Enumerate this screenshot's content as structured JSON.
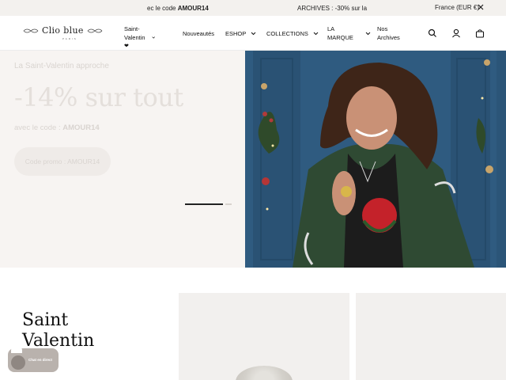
{
  "announcement": {
    "message1_prefix": "ec le code ",
    "message1_code": "AMOUR14",
    "message2": "ARCHIVES : -30% sur la",
    "locale_label": "France (EUR €)",
    "close_icon": "close-icon"
  },
  "header": {
    "logo_text_left": "Clio",
    "logo_text_right": "blue",
    "logo_subtext": "PARIS",
    "nav": [
      {
        "label_line1": "Saint-Valentin",
        "label_line2": "❤",
        "has_chevron": true
      },
      {
        "label": "Nouveautés",
        "has_chevron": false
      },
      {
        "label": "ESHOP",
        "has_chevron": true
      },
      {
        "label": "COLLECTIONS",
        "has_chevron": true
      },
      {
        "label_line1": "LA",
        "label_line2": "MARQUE",
        "has_chevron": true
      },
      {
        "label_line1": "Nos",
        "label_line2": "Archives",
        "has_chevron": false
      }
    ],
    "icons": [
      "search-icon",
      "account-icon",
      "cart-icon"
    ]
  },
  "hero": {
    "kicker": "La Saint-Valentin approche",
    "title": "-14% sur tout",
    "code_prefix": "avec le code : ",
    "code": "AMOUR14",
    "button_label": "Code promo : AMOUR14",
    "slides": 2,
    "active_slide": 1
  },
  "section": {
    "title_line1": "Saint",
    "title_line2": "Valentin"
  },
  "chat": {
    "label": "Chat en direct"
  },
  "colors": {
    "hero_bg": "#f7f4f2",
    "hero_text": "#e4dfdb",
    "photo_wall": "#2e5a80",
    "accent": "#222222"
  }
}
